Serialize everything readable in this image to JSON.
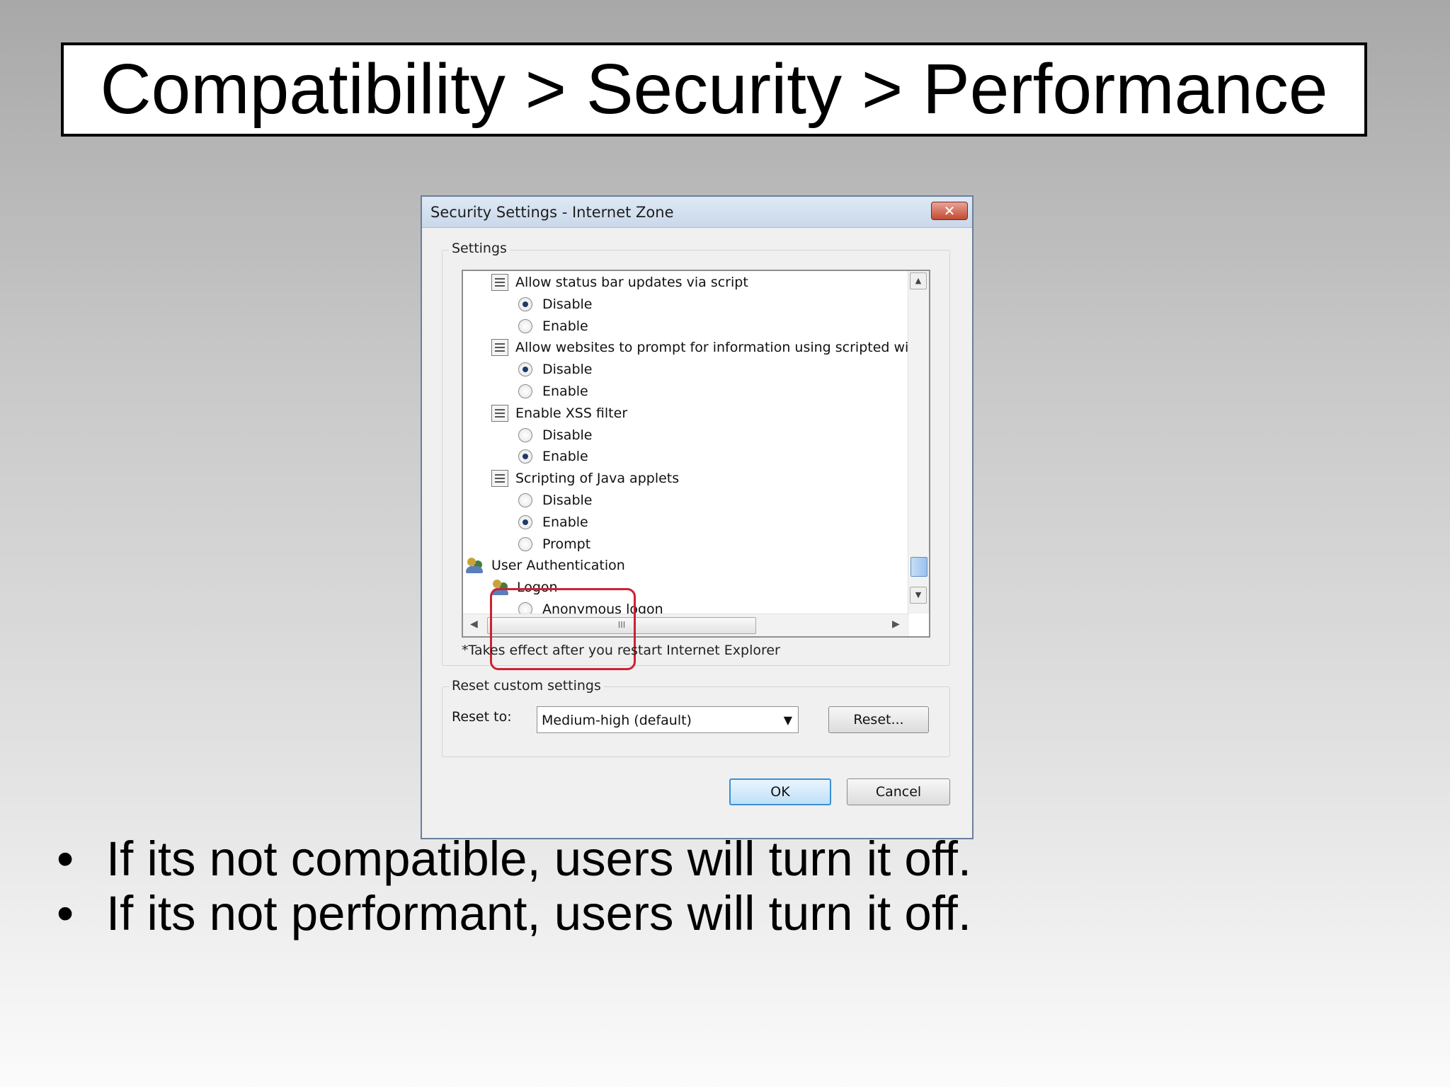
{
  "slide": {
    "title": "Compatibility > Security > Performance",
    "bullets": [
      "If its not compatible, users will turn it off.",
      "If its not performant, users will turn it off."
    ],
    "bullet_char": "•"
  },
  "dialog": {
    "title": "Security Settings - Internet Zone",
    "close_glyph": "✕",
    "settings_group_label": "Settings",
    "tree": [
      {
        "type": "script",
        "label": "Allow status bar updates via script"
      },
      {
        "type": "radio",
        "label": "Disable",
        "checked": true
      },
      {
        "type": "radio",
        "label": "Enable",
        "checked": false
      },
      {
        "type": "script",
        "label": "Allow websites to prompt for information using scripted windo"
      },
      {
        "type": "radio",
        "label": "Disable",
        "checked": true
      },
      {
        "type": "radio",
        "label": "Enable",
        "checked": false
      },
      {
        "type": "script",
        "label": "Enable XSS filter"
      },
      {
        "type": "radio",
        "label": "Disable",
        "checked": false
      },
      {
        "type": "radio",
        "label": "Enable",
        "checked": true
      },
      {
        "type": "script",
        "label": "Scripting of Java applets"
      },
      {
        "type": "radio",
        "label": "Disable",
        "checked": false
      },
      {
        "type": "radio",
        "label": "Enable",
        "checked": true
      },
      {
        "type": "radio",
        "label": "Prompt",
        "checked": false
      },
      {
        "type": "user",
        "label": "User Authentication"
      },
      {
        "type": "user",
        "label": "Logon"
      },
      {
        "type": "radio",
        "label": "Anonymous logon",
        "checked": false
      }
    ],
    "hscroll_grip": "III",
    "note": "*Takes effect after you restart Internet Explorer",
    "reset_group_label": "Reset custom settings",
    "reset_to_label": "Reset to:",
    "reset_to_value": "Medium-high (default)",
    "reset_button": "Reset...",
    "ok_button": "OK",
    "cancel_button": "Cancel",
    "highlight_color": "#cc2233"
  }
}
